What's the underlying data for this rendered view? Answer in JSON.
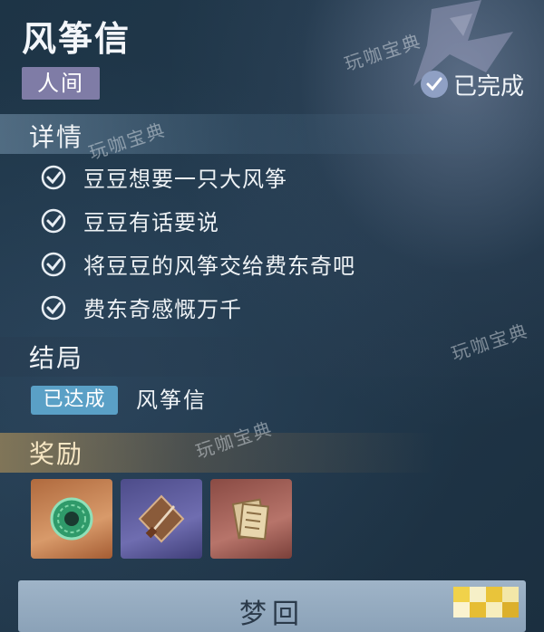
{
  "header": {
    "title": "风筝信",
    "tag": "人间",
    "status": "已完成"
  },
  "details": {
    "section_title": "详情",
    "items": [
      "豆豆想要一只大风筝",
      "豆豆有话要说",
      "将豆豆的风筝交给费东奇吧",
      "费东奇感慨万千"
    ]
  },
  "ending": {
    "section_title": "结局",
    "badge": "已达成",
    "name": "风筝信"
  },
  "rewards": {
    "section_title": "奖励",
    "items": [
      {
        "icon": "jade-pendant-icon"
      },
      {
        "icon": "dagger-icon"
      },
      {
        "icon": "scroll-letter-icon"
      }
    ]
  },
  "action": {
    "button_label": "梦回"
  },
  "watermark": "玩咖宝典",
  "colors": {
    "tag_bg": "#7f7ca6",
    "ending_badge_bg": "#5aa0c6",
    "button_bg": "#9fb4c8",
    "reward_bar": "#c8a05a"
  }
}
